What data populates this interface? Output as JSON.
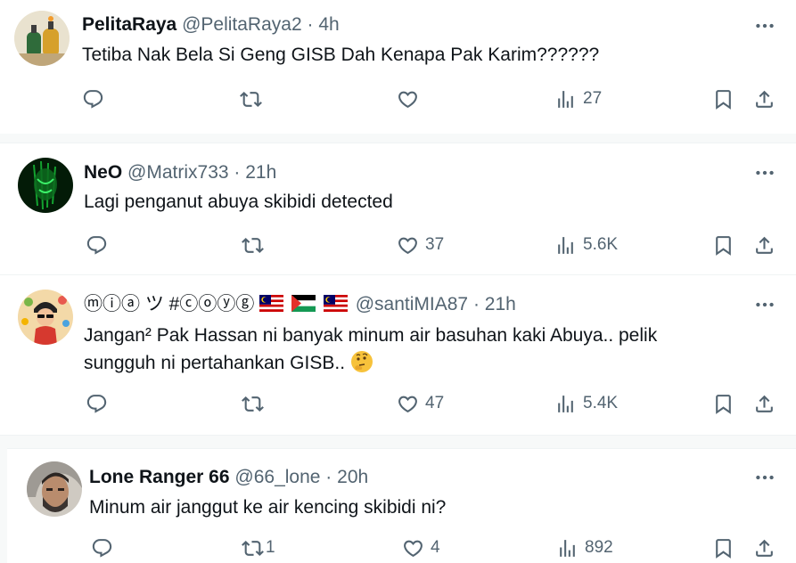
{
  "tweets": [
    {
      "name": "PelitaRaya",
      "handle": "@PelitaRaya2",
      "sep": "·",
      "time": "4h",
      "text_lines": [
        "Tetiba Nak Bela Si Geng GISB Dah Kenapa Pak Karim??????"
      ],
      "replies": "",
      "retweets": "",
      "likes": "",
      "views": "27"
    },
    {
      "name": "NeO",
      "handle": "@Matrix733",
      "sep": "·",
      "time": "21h",
      "text_lines": [
        "Lagi penganut abuya skibidi detected"
      ],
      "replies": "",
      "retweets": "",
      "likes": "37",
      "views": "5.6K"
    },
    {
      "name": "ⓜⓘⓐ ツ #ⓒⓞⓨⓖ",
      "handle": "@santiMIA87",
      "sep": "·",
      "time": "21h",
      "text_lines": [
        "Jangan² Pak Hassan ni banyak minum air basuhan kaki Abuya.. pelik",
        "sungguh ni pertahankan GISB.."
      ],
      "replies": "",
      "retweets": "",
      "likes": "47",
      "views": "5.4K"
    },
    {
      "name": "Lone Ranger 66",
      "handle": "@66_lone",
      "sep": "·",
      "time": "20h",
      "text_lines": [
        "Minum air janggut ke air kencing skibidi ni?"
      ],
      "replies": "",
      "retweets": "1",
      "likes": "4",
      "views": "892"
    }
  ],
  "icons": {
    "more": "more-icon",
    "reply": "reply-icon",
    "retweet": "retweet-icon",
    "like": "heart-icon",
    "views": "views-icon",
    "bookmark": "bookmark-icon",
    "share": "share-icon"
  },
  "colors": {
    "text": "#0f1419",
    "secondary": "#536471",
    "divider": "#eff3f4"
  }
}
